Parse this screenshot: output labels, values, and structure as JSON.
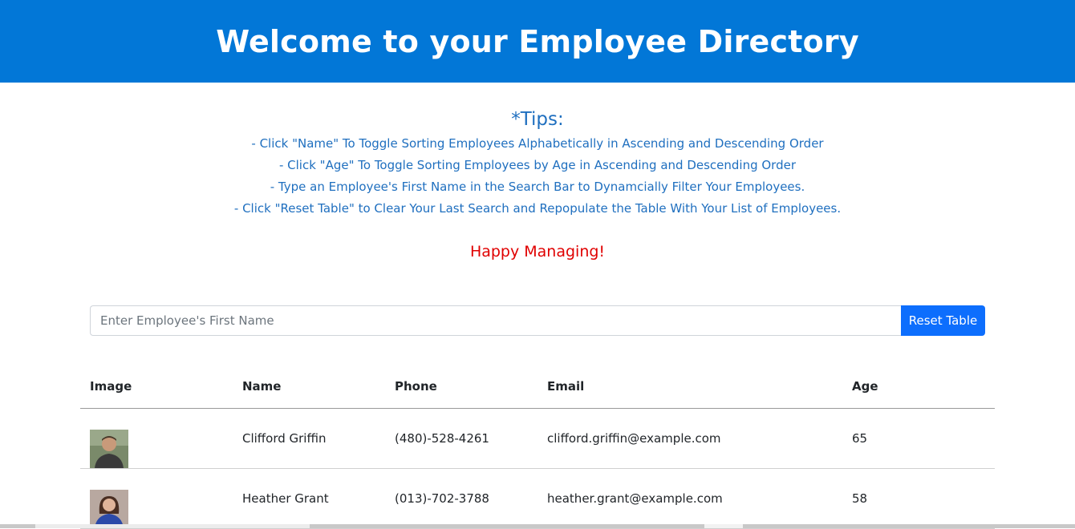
{
  "header": {
    "title": "Welcome to your Employee Directory",
    "bg_color": "#0277d7"
  },
  "tips": {
    "title": "*Tips:",
    "lines": [
      "- Click \"Name\" To Toggle Sorting Employees Alphabetically in Ascending and Descending Order",
      "- Click \"Age\" To Toggle Sorting Employees by Age in Ascending and Descending Order",
      "- Type an Employee's First Name in the Search Bar to Dynamcially Filter Your Employees.",
      "- Click \"Reset Table\" to Clear Your Last Search and Repopulate the Table With Your List of Employees."
    ],
    "color": "#1f6fbf"
  },
  "happy": {
    "text": "Happy Managing!",
    "color": "#e00000"
  },
  "search": {
    "placeholder": "Enter Employee's First Name",
    "value": "",
    "reset_label": "Reset Table",
    "button_color": "#0d6efd"
  },
  "table": {
    "headers": {
      "image": "Image",
      "name": "Name",
      "phone": "Phone",
      "email": "Email",
      "age": "Age"
    },
    "rows": [
      {
        "avatar_icon": "man-avatar-icon",
        "name": "Clifford Griffin",
        "phone": "(480)-528-4261",
        "email": "clifford.griffin@example.com",
        "age": "65"
      },
      {
        "avatar_icon": "woman-avatar-icon",
        "name": "Heather Grant",
        "phone": "(013)-702-3788",
        "email": "heather.grant@example.com",
        "age": "58"
      }
    ]
  }
}
